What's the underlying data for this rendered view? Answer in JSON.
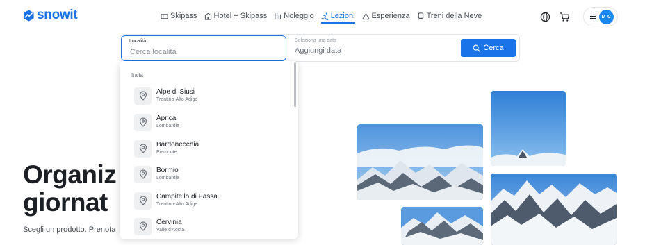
{
  "brand": {
    "name": "snowit",
    "color": "#1a73e8"
  },
  "nav": [
    {
      "label": "Skipass",
      "icon": "ticket-icon",
      "active": false
    },
    {
      "label": "Hotel + Skipass",
      "icon": "hotel-icon",
      "active": false
    },
    {
      "label": "Noleggio",
      "icon": "skis-icon",
      "active": false
    },
    {
      "label": "Lezioni",
      "icon": "skier-icon",
      "active": true
    },
    {
      "label": "Esperienza",
      "icon": "mountain-icon",
      "active": false
    },
    {
      "label": "Treni della Neve",
      "icon": "train-icon",
      "active": false
    }
  ],
  "header": {
    "avatar_initials": "M C"
  },
  "search": {
    "location_label": "Località",
    "location_placeholder": "Cerca località",
    "date_label": "Seleziona una data",
    "date_value": "Aggiungi data",
    "button_label": "Cerca"
  },
  "dropdown": {
    "group": "Italia",
    "results": [
      {
        "name": "Alpe di Siusi",
        "region": "Trentino-Alto Adige"
      },
      {
        "name": "Aprica",
        "region": "Lombardia"
      },
      {
        "name": "Bardonecchia",
        "region": "Piemonte"
      },
      {
        "name": "Bormio",
        "region": "Lombardia"
      },
      {
        "name": "Campitello di Fassa",
        "region": "Trentino-Alto Adige"
      },
      {
        "name": "Cervinia",
        "region": "Valle d'Aosta"
      }
    ]
  },
  "hero": {
    "title_line1": "Organiz",
    "title_line2": "giornat",
    "subtitle": "Scegli un prodotto. Prenota"
  }
}
